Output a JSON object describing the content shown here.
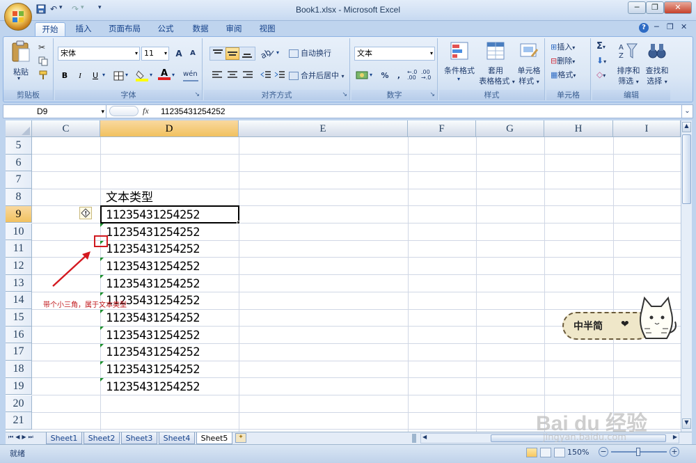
{
  "window": {
    "title": "Book1.xlsx - Microsoft Excel"
  },
  "qat": {
    "save_icon": "save-icon",
    "undo": "↶",
    "redo": "↷",
    "customize": "▾"
  },
  "window_controls": {
    "minimize": "─",
    "restore": "❐",
    "close": "✕"
  },
  "tabs": [
    "开始",
    "插入",
    "页面布局",
    "公式",
    "数据",
    "审阅",
    "视图"
  ],
  "active_tab": "开始",
  "ribbon": {
    "clipboard": {
      "paste": "粘贴",
      "label": "剪贴板"
    },
    "font": {
      "name": "宋体",
      "size": "11",
      "grow": "A",
      "shrink": "A",
      "bold": "B",
      "italic": "I",
      "underline": "U",
      "label": "字体"
    },
    "alignment": {
      "wrap": "自动换行",
      "merge": "合并后居中",
      "label": "对齐方式"
    },
    "number": {
      "format": "文本",
      "percent": "%",
      "comma": ",",
      "label": "数字"
    },
    "styles": {
      "conditional": "条件格式",
      "table1": "套用",
      "table2": "表格格式",
      "cell1": "单元格",
      "cell2": "样式",
      "label": "样式"
    },
    "cells": {
      "insert": "插入",
      "delete": "删除",
      "format": "格式",
      "label": "单元格"
    },
    "editing": {
      "sum": "Σ",
      "sort1": "排序和",
      "sort2": "筛选",
      "find1": "查找和",
      "find2": "选择",
      "label": "编辑"
    }
  },
  "formula_bar": {
    "name_box": "D9",
    "fx": "fx",
    "value": "11235431254252"
  },
  "columns": [
    "C",
    "D",
    "E",
    "F",
    "G",
    "H",
    "I"
  ],
  "selected_column": "D",
  "rows": [
    "5",
    "6",
    "7",
    "8",
    "9",
    "10",
    "11",
    "12",
    "13",
    "14",
    "15",
    "16",
    "17",
    "18",
    "19",
    "20",
    "21"
  ],
  "selected_row": "9",
  "cells": {
    "D8": "文本类型",
    "D9": "11235431254252",
    "D10": "11235431254252",
    "D11": "11235431254252",
    "D12": "11235431254252",
    "D13": "11235431254252",
    "D14": "11235431254252",
    "D15": "11235431254252",
    "D16": "11235431254252",
    "D17": "11235431254252",
    "D18": "11235431254252",
    "D19": "11235431254252"
  },
  "annotation": {
    "text": "带个小三角，属于文本类型",
    "color": "#c0161a"
  },
  "sheets": [
    "Sheet1",
    "Sheet2",
    "Sheet3",
    "Sheet4",
    "Sheet5"
  ],
  "active_sheet": "Sheet5",
  "status": {
    "ready": "就绪",
    "zoom": "150%"
  },
  "sticker": {
    "text": "中半简"
  },
  "watermark": {
    "brand": "Bai du 经验",
    "url": "jingyan.baidu.com"
  }
}
